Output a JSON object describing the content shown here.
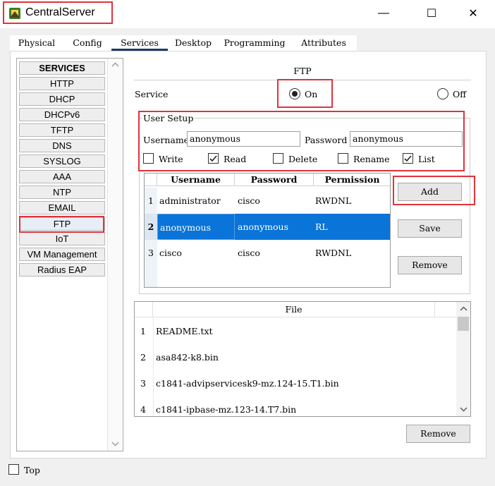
{
  "window": {
    "title": "CentralServer",
    "minimize": "—",
    "maximize": "☐",
    "close": "✕"
  },
  "tabs": [
    "Physical",
    "Config",
    "Services",
    "Desktop",
    "Programming",
    "Attributes"
  ],
  "active_tab": "Services",
  "services": {
    "header": "SERVICES",
    "items": [
      "HTTP",
      "DHCP",
      "DHCPv6",
      "TFTP",
      "DNS",
      "SYSLOG",
      "AAA",
      "NTP",
      "EMAIL",
      "FTP",
      "IoT",
      "VM Management",
      "Radius EAP"
    ],
    "selected": "FTP"
  },
  "ftp": {
    "title": "FTP",
    "service_label": "Service",
    "on_label": "On",
    "off_label": "Off",
    "service_state": "On",
    "user_setup": {
      "legend": "User Setup",
      "username_label": "Username",
      "username_value": "anonymous",
      "password_label": "Password",
      "password_value": "anonymous",
      "permissions": [
        {
          "label": "Write",
          "checked": false
        },
        {
          "label": "Read",
          "checked": true
        },
        {
          "label": "Delete",
          "checked": false
        },
        {
          "label": "Rename",
          "checked": false
        },
        {
          "label": "List",
          "checked": true
        }
      ]
    },
    "table": {
      "headers": [
        "Username",
        "Password",
        "Permission"
      ],
      "rows": [
        {
          "num": "1",
          "username": "administrator",
          "password": "cisco",
          "permission": "RWDNL"
        },
        {
          "num": "2",
          "username": "anonymous",
          "password": "anonymous",
          "permission": "RL"
        },
        {
          "num": "3",
          "username": "cisco",
          "password": "cisco",
          "permission": "RWDNL"
        }
      ],
      "selected_row": "2"
    },
    "buttons": {
      "add": "Add",
      "save": "Save",
      "remove": "Remove"
    },
    "files": {
      "header": "File",
      "rows": [
        {
          "num": "1",
          "name": "README.txt"
        },
        {
          "num": "2",
          "name": "asa842-k8.bin"
        },
        {
          "num": "3",
          "name": "c1841-advipservicesk9-mz.124-15.T1.bin"
        },
        {
          "num": "4",
          "name": "c1841-ipbase-mz.123-14.T7.bin"
        }
      ],
      "remove": "Remove"
    }
  },
  "footer": {
    "top_label": "Top",
    "top_checked": false
  },
  "colors": {
    "selection": "#0a74d8",
    "annotation_red": "#e0333c",
    "active_tab_underline": "#1b3a66"
  }
}
